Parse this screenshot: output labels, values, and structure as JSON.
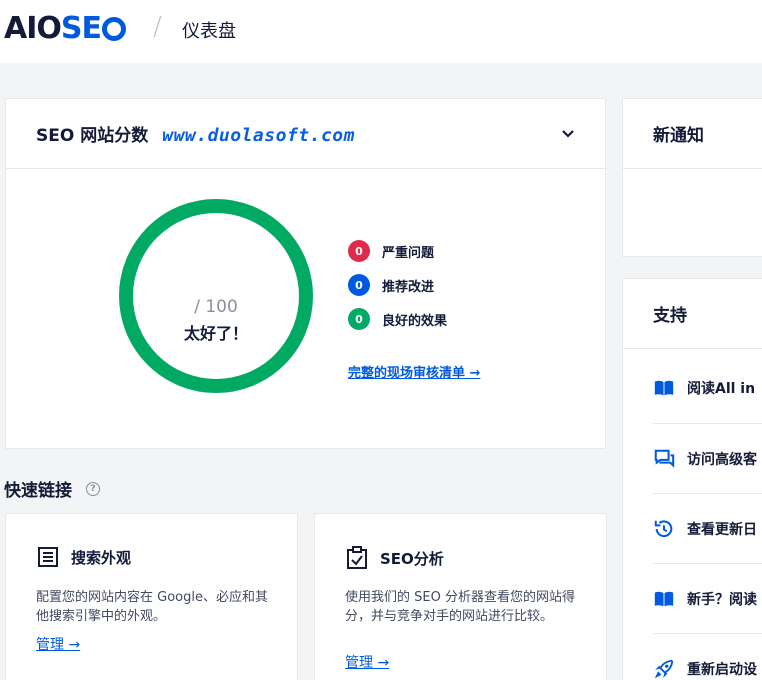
{
  "header": {
    "logo_aio": "AIO",
    "logo_seo": "SE",
    "separator": "/",
    "title": "仪表盘"
  },
  "score_card": {
    "title": "SEO 网站分数",
    "watermark": "www.duolasoft.com",
    "score_denominator": "/ 100",
    "score_label": "太好了！",
    "legend": [
      {
        "count": "0",
        "label": "严重问题",
        "color": "#df2a4a"
      },
      {
        "count": "0",
        "label": "推荐改进",
        "color": "#005ae0"
      },
      {
        "count": "0",
        "label": "良好的效果",
        "color": "#00aa63"
      }
    ],
    "audit_link": "完整的现场审核清单 →"
  },
  "notice_card": {
    "title": "新通知"
  },
  "support_card": {
    "title": "支持",
    "items": [
      {
        "label": "阅读All in",
        "icon": "book-icon"
      },
      {
        "label": "访问高级客",
        "icon": "chat-icon"
      },
      {
        "label": "查看更新日",
        "icon": "history-icon"
      },
      {
        "label": "新手？阅读",
        "icon": "book-icon"
      },
      {
        "label": "重新启动设",
        "icon": "rocket-icon"
      }
    ]
  },
  "quick_links": {
    "title": "快速链接",
    "help": "?",
    "cards": [
      {
        "title": "搜索外观",
        "desc": "配置您的网站内容在 Google、必应和其他搜索引擎中的外观。",
        "link": "管理 →",
        "icon": "list-icon"
      },
      {
        "title": "SEO分析",
        "desc": "使用我们的 SEO 分析器查看您的网站得分，并与竞争对手的网站进行比较。",
        "link": "管理 →",
        "icon": "clipboard-check-icon"
      }
    ]
  },
  "colors": {
    "accent": "#005ae0",
    "good": "#00aa63",
    "critical": "#df2a4a",
    "text": "#141b38"
  }
}
